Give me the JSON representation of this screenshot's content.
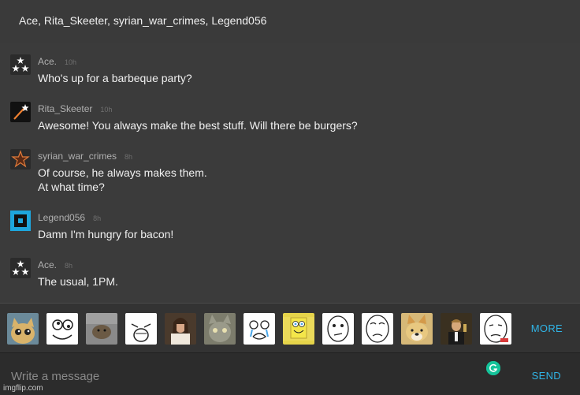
{
  "header": {
    "title": "Ace, Rita_Skeeter, syrian_war_crimes, Legend056"
  },
  "messages": [
    {
      "username": "Ace.",
      "time": "10h",
      "lines": [
        "Who's up for a barbeque party?"
      ],
      "avatar_icon": "three-stars-icon"
    },
    {
      "username": "Rita_Skeeter",
      "time": "10h",
      "lines": [
        "Awesome! You always make the best stuff. Will there be burgers?"
      ],
      "avatar_icon": "shooting-star-icon"
    },
    {
      "username": "syrian_war_crimes",
      "time": "8h",
      "lines": [
        "Of course, he always makes them.",
        "At what time?"
      ],
      "avatar_icon": "star-outline-icon"
    },
    {
      "username": "Legend056",
      "time": "8h",
      "lines": [
        "Damn I'm hungry for bacon!"
      ],
      "avatar_icon": "blue-square-icon"
    },
    {
      "username": "Ace.",
      "time": "8h",
      "lines": [
        "The usual, 1PM."
      ],
      "avatar_icon": "three-stars-icon"
    }
  ],
  "stickers": [
    "cat-sticker",
    "derp-face-sticker",
    "cat-photo-sticker",
    "lol-face-sticker",
    "jesus-sticker",
    "cat-face-sticker",
    "tears-face-sticker",
    "spongebob-sticker",
    "thinking-face-sticker",
    "okay-face-sticker",
    "doge-sticker",
    "leo-cheers-sticker",
    "okay-sad-face-sticker"
  ],
  "sticker_bar": {
    "more_label": "MORE"
  },
  "composer": {
    "placeholder": "Write a message",
    "send_label": "SEND"
  },
  "watermark": "imgflip.com",
  "colors": {
    "accent": "#30b4e6",
    "background": "#3b3b3b",
    "composer_background": "#2c2c2c"
  }
}
